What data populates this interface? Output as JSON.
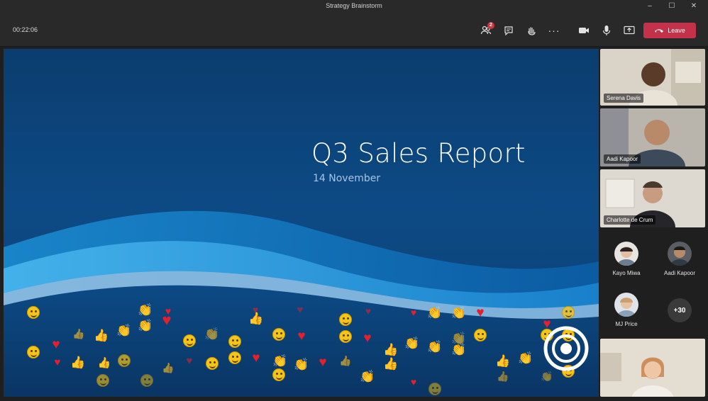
{
  "window": {
    "title": "Strategy Brainstorm",
    "controls": {
      "minimize": "–",
      "maximize": "☐",
      "close": "✕"
    }
  },
  "toolbar": {
    "timer": "00:22:06",
    "participants_badge": "2",
    "leave_label": "Leave",
    "icons": [
      "participants-icon",
      "chat-icon",
      "raise-hand-icon",
      "more-options-icon",
      "camera-icon",
      "microphone-icon",
      "share-screen-icon",
      "phone-hangup-icon"
    ],
    "leave_color": "#c4314b"
  },
  "slide": {
    "title": "Q3 Sales Report",
    "subtitle": "14 November"
  },
  "participants": {
    "video_tiles": [
      {
        "name": "Serena Davis"
      },
      {
        "name": "Aadi Kapoor"
      },
      {
        "name": "Charlotte de Crum"
      }
    ],
    "avatars": [
      {
        "name": "Kayo Miwa"
      },
      {
        "name": "Aadi Kapoor"
      },
      {
        "name": "MJ Price"
      }
    ],
    "more_count": "+30"
  },
  "reactions": {
    "types": [
      "laugh",
      "heart",
      "clap",
      "thumbs-up"
    ]
  }
}
